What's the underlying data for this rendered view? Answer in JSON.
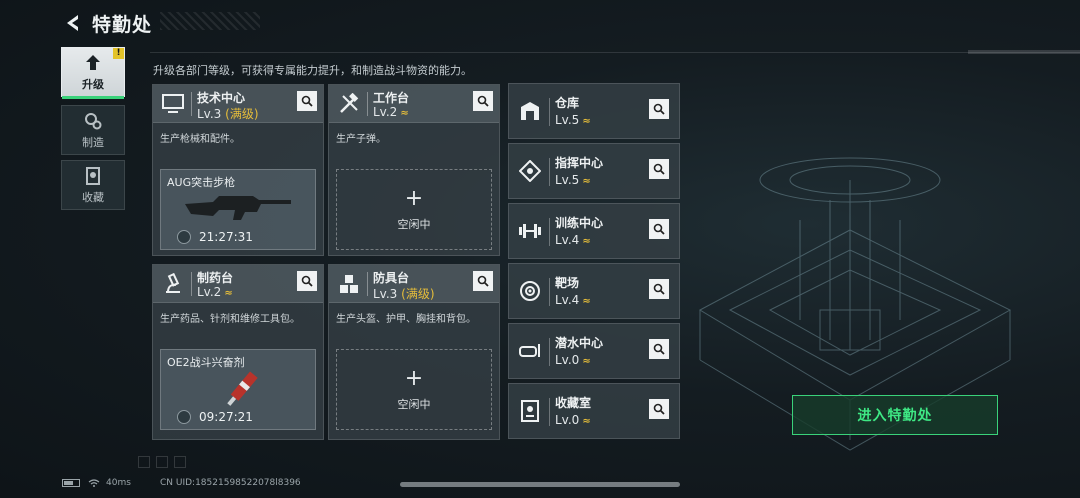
{
  "header": {
    "title": "特勤处"
  },
  "intro": "升级各部门等级，可获得专属能力提升，和制造战斗物资的能力。",
  "side_tabs": [
    {
      "label": "升级",
      "active": true,
      "badge": "!"
    },
    {
      "label": "制造",
      "active": false
    },
    {
      "label": "收藏",
      "active": false
    }
  ],
  "cards": {
    "tech": {
      "name": "技术中心",
      "level": "Lv.3",
      "max": "(满级)",
      "desc": "生产枪械和配件。",
      "product": {
        "name": "AUG突击步枪",
        "timer": "21:27:31"
      }
    },
    "workbench": {
      "name": "工作台",
      "level": "Lv.2",
      "desc": "生产子弹。",
      "idle": "空闲中"
    },
    "pharmacy": {
      "name": "制药台",
      "level": "Lv.2",
      "desc": "生产药品、针剂和维修工具包。",
      "product": {
        "name": "OE2战斗兴奋剂",
        "timer": "09:27:21"
      }
    },
    "armor": {
      "name": "防具台",
      "level": "Lv.3",
      "max": "(满级)",
      "desc": "生产头盔、护甲、胸挂和背包。",
      "idle": "空闲中"
    }
  },
  "right_list": [
    {
      "name": "仓库",
      "level": "Lv.5",
      "icon": "warehouse-icon"
    },
    {
      "name": "指挥中心",
      "level": "Lv.5",
      "icon": "command-icon"
    },
    {
      "name": "训练中心",
      "level": "Lv.4",
      "icon": "dumbbell-icon"
    },
    {
      "name": "靶场",
      "level": "Lv.4",
      "icon": "target-icon"
    },
    {
      "name": "潜水中心",
      "level": "Lv.0",
      "icon": "dive-mask-icon"
    },
    {
      "name": "收藏室",
      "level": "Lv.0",
      "icon": "collection-icon"
    }
  ],
  "upgrade_mark": "≈",
  "enter_button": "进入特勤处",
  "status": {
    "ping": "40ms",
    "uid": "CN UID:18521598522078l8396"
  },
  "colors": {
    "accent": "#3ad27a",
    "gold": "#e5bd3a"
  }
}
